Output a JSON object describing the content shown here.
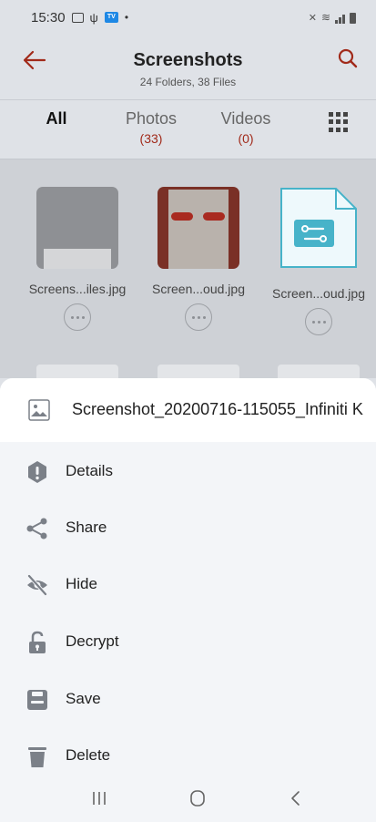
{
  "status": {
    "time": "15:30"
  },
  "header": {
    "title": "Screenshots",
    "subtitle": "24 Folders, 38 Files"
  },
  "tabs": [
    {
      "label": "All",
      "count": ""
    },
    {
      "label": "Photos",
      "count": "(33)"
    },
    {
      "label": "Videos",
      "count": "(0)"
    }
  ],
  "files": [
    {
      "name": "Screens...iles.jpg"
    },
    {
      "name": "Screen...oud.jpg"
    },
    {
      "name": "Screen...oud.jpg"
    }
  ],
  "sheet": {
    "filename": "Screenshot_20200716-115055_Infiniti K...",
    "actions": [
      {
        "label": "Details",
        "icon": "info-icon"
      },
      {
        "label": "Share",
        "icon": "share-icon"
      },
      {
        "label": "Hide",
        "icon": "hide-icon"
      },
      {
        "label": "Decrypt",
        "icon": "unlock-icon"
      },
      {
        "label": "Save",
        "icon": "save-icon"
      },
      {
        "label": "Delete",
        "icon": "delete-icon"
      }
    ]
  },
  "colors": {
    "accent": "#a12a1a",
    "icon": "#7b8088",
    "file_icon": "#47b3c9"
  }
}
